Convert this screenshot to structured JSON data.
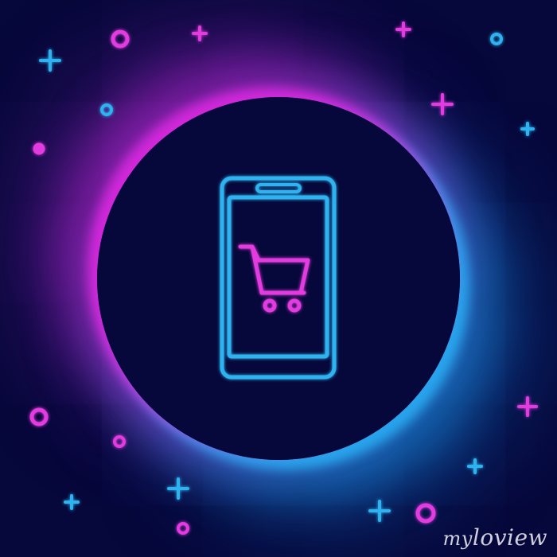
{
  "scene": {
    "subject": "smartphone-with-shopping-cart-icon",
    "colors": {
      "background": "#06073a",
      "magenta": "#e23ae0",
      "cyan": "#2fb3f0",
      "ring_magenta": "#d628dc",
      "ring_cyan": "#28aaf0"
    }
  },
  "icons": {
    "phone": "smartphone-icon",
    "cart": "shopping-cart-icon"
  },
  "watermark": {
    "prefix": "my",
    "name": "loview"
  }
}
